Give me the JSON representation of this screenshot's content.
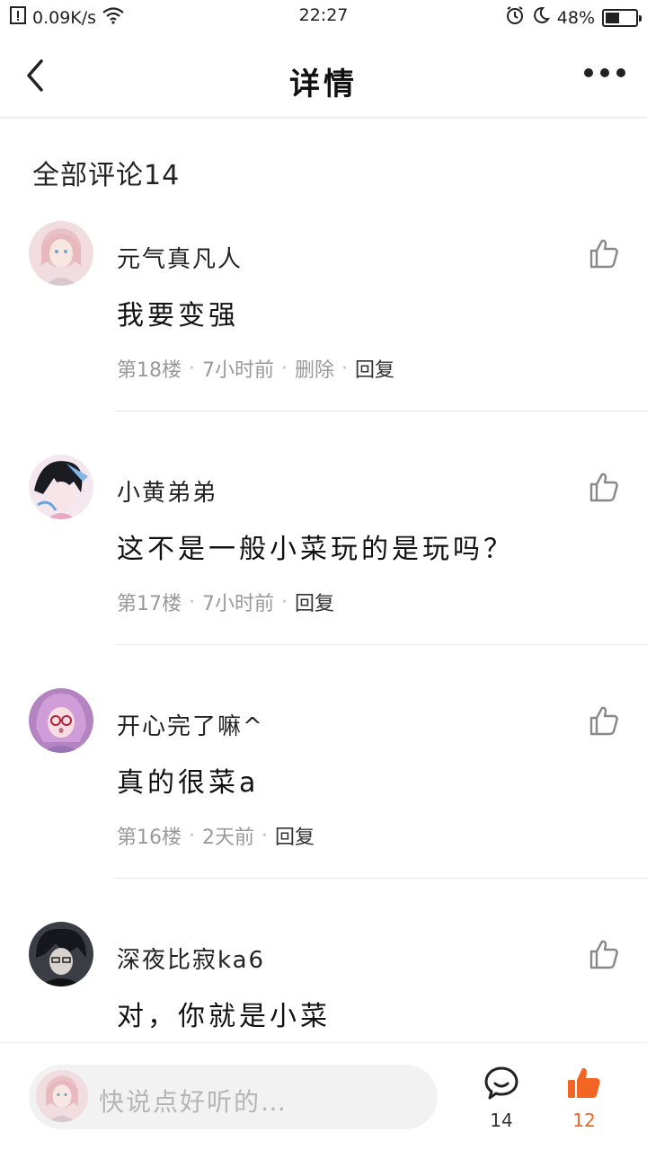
{
  "status_bar": {
    "speed": "0.09K/s",
    "time": "22:27",
    "battery": "48%",
    "battery_level": 0.48
  },
  "nav": {
    "title": "详情"
  },
  "section": {
    "title": "全部评论14"
  },
  "comments": [
    {
      "username": "元气真凡人",
      "content": "我要变强",
      "floor": "第18楼",
      "time": "7小时前",
      "delete": "删除",
      "reply": "回复"
    },
    {
      "username": "小黄弟弟",
      "content": "这不是一般小菜玩的是玩吗？",
      "floor": "第17楼",
      "time": "7小时前",
      "reply": "回复"
    },
    {
      "username": "开心完了嘛^",
      "content": "真的很菜a",
      "floor": "第16楼",
      "time": "2天前",
      "reply": "回复"
    },
    {
      "username": "深夜比寂ka6",
      "content": "对，你就是小菜"
    }
  ],
  "bottom_bar": {
    "placeholder": "快说点好听的…",
    "comment_count": "14",
    "like_count": "12"
  },
  "colors": {
    "accent": "#f26522",
    "text": "#222222",
    "meta": "#999999",
    "divider": "#e6e6e6"
  },
  "icons": [
    "file-icon",
    "wifi-icon",
    "alarm-icon",
    "moon-icon",
    "battery-icon",
    "back-arrow-icon",
    "more-icon",
    "thumbs-up-icon",
    "comment-bubble-icon",
    "thumbs-up-filled-icon"
  ]
}
